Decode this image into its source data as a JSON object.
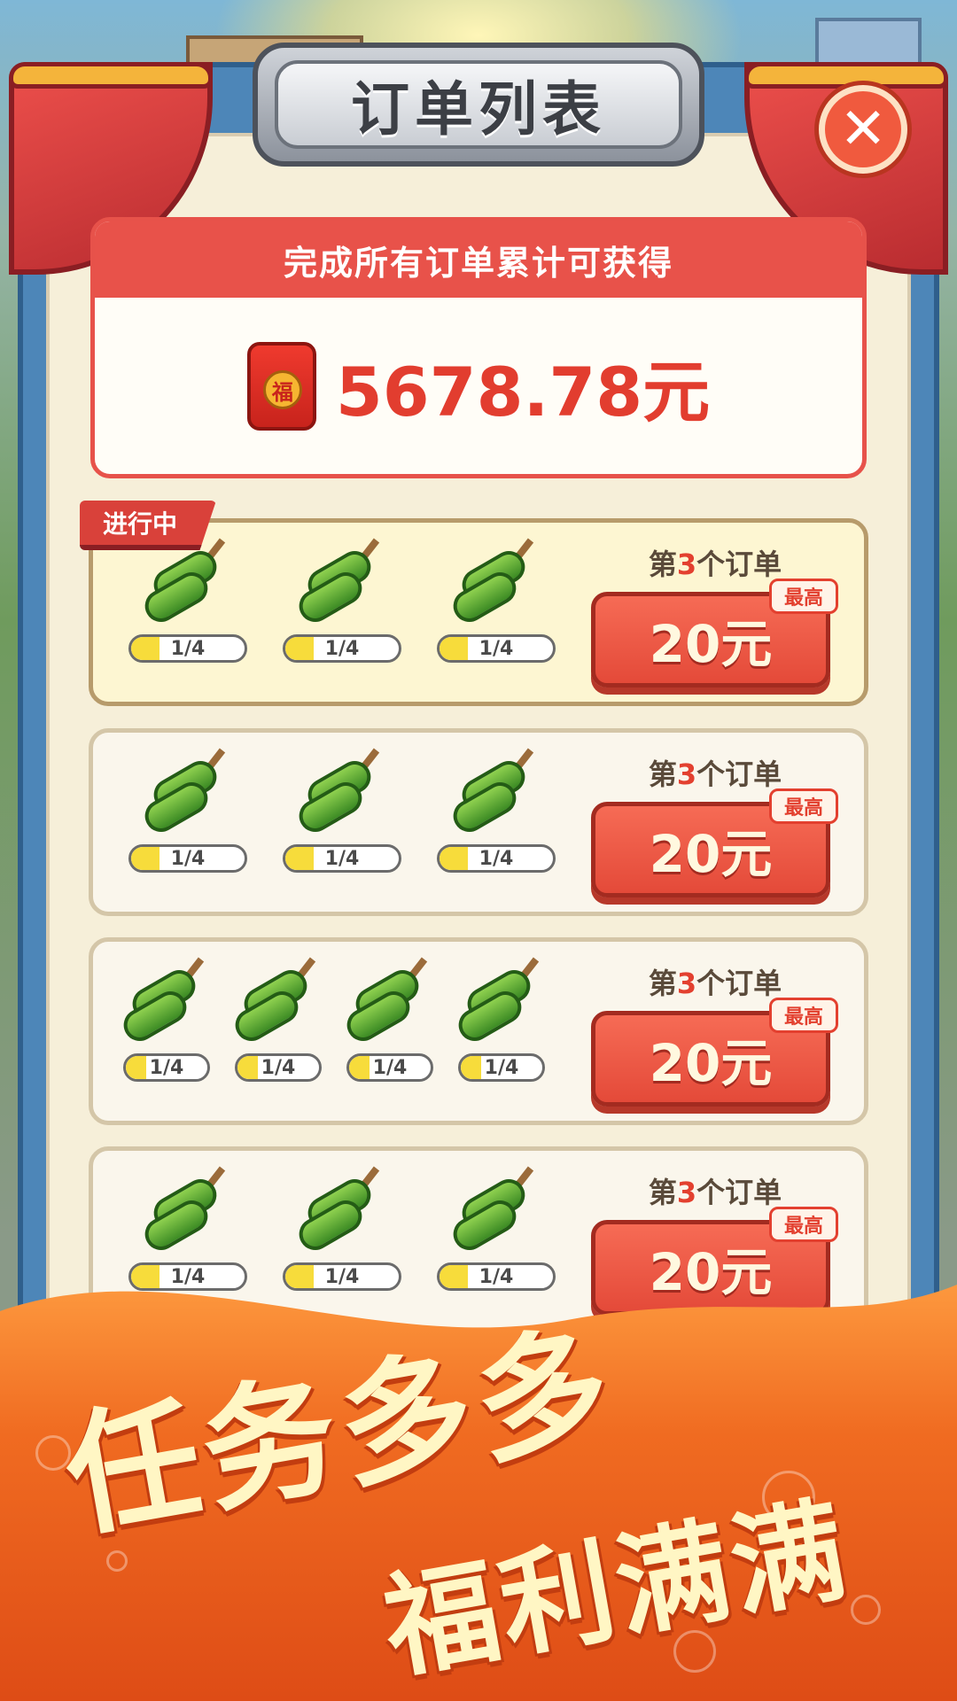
{
  "title": "订单列表",
  "close_icon": "close-icon",
  "total": {
    "header": "完成所有订单累计可获得",
    "amount": "5678.78元",
    "seal_char": "福"
  },
  "active_tag": "进行中",
  "orders": [
    {
      "label_prefix": "第",
      "label_num": "3",
      "label_suffix": "个订单",
      "reward": "20元",
      "badge": "最高",
      "items": [
        {
          "progress": "1/4"
        },
        {
          "progress": "1/4"
        },
        {
          "progress": "1/4"
        }
      ]
    },
    {
      "label_prefix": "第",
      "label_num": "3",
      "label_suffix": "个订单",
      "reward": "20元",
      "badge": "最高",
      "items": [
        {
          "progress": "1/4"
        },
        {
          "progress": "1/4"
        },
        {
          "progress": "1/4"
        }
      ]
    },
    {
      "label_prefix": "第",
      "label_num": "3",
      "label_suffix": "个订单",
      "reward": "20元",
      "badge": "最高",
      "items": [
        {
          "progress": "1/4"
        },
        {
          "progress": "1/4"
        },
        {
          "progress": "1/4"
        },
        {
          "progress": "1/4"
        }
      ]
    },
    {
      "label_prefix": "第",
      "label_num": "3",
      "label_suffix": "个订单",
      "reward": "20元",
      "badge": "最高",
      "items": [
        {
          "progress": "1/4"
        },
        {
          "progress": "1/4"
        },
        {
          "progress": "1/4"
        }
      ]
    }
  ],
  "progress_fraction": 0.25,
  "promo": {
    "line1": "任务多多",
    "line2": "福利满满"
  }
}
